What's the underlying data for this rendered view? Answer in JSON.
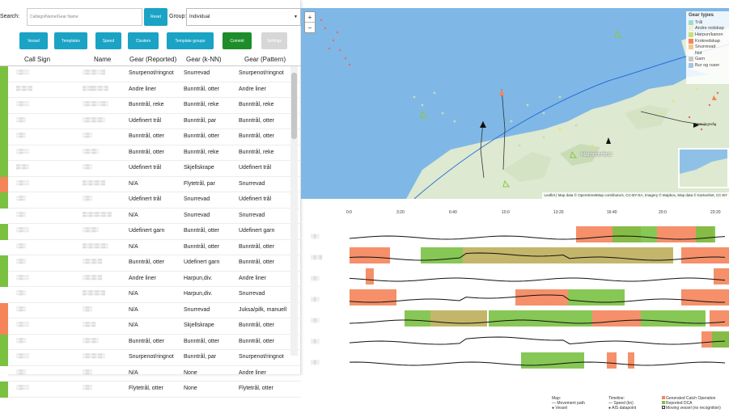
{
  "search": {
    "label": "Search:",
    "placeholder": "Callsign/Name/Gear Name",
    "reset_label": "Reset"
  },
  "group": {
    "label": "Group:",
    "value": "Individual"
  },
  "toolbar": {
    "vessel": "Vessel",
    "templates": "Templates",
    "speed": "Speed",
    "clusters": "Clusters",
    "template_groups": "Template groups",
    "commit": "Commit",
    "settings": "Settings"
  },
  "table": {
    "headers": [
      "Call Sign",
      "Name",
      "Gear (Reported)",
      "Gear (k-NN)",
      "Gear (Pattern)"
    ],
    "rows": [
      {
        "flag": "#7ac142",
        "cs": "░▒░░",
        "nm": "░▒░▒░░▒",
        "rep": "Snurpenot/ringnot",
        "knn": "Snurrevad",
        "pat": "Snurpenot/ringnot"
      },
      {
        "flag": "#7ac142",
        "cs": "▒░▒░▒",
        "nm": "▒░▒▒░▒░▒",
        "rep": "Andre liner",
        "knn": "Bunntrål, otter",
        "pat": "Andre liner"
      },
      {
        "flag": "#7ac142",
        "cs": "░▒░░",
        "nm": "░▒░▒░░▒░",
        "rep": "Bunntrål, reke",
        "knn": "Bunntrål, reke",
        "pat": "Bunntrål, reke"
      },
      {
        "flag": "#7ac142",
        "cs": "░▒░",
        "nm": "░▒░▒░▒░",
        "rep": "Udefinert trål",
        "knn": "Bunntrål, par",
        "pat": "Bunntrål, otter"
      },
      {
        "flag": "#7ac142",
        "cs": "░▒░",
        "nm": "░▒░",
        "rep": "Bunntrål, otter",
        "knn": "Bunntrål, otter",
        "pat": "Bunntrål, otter"
      },
      {
        "flag": "#7ac142",
        "cs": "░▒░░",
        "nm": "░▒░▒░",
        "rep": "Bunntrål, otter",
        "knn": "Bunntrål, reke",
        "pat": "Bunntrål, reke"
      },
      {
        "flag": "#7ac142",
        "cs": "▒░▒░",
        "nm": "░▒░",
        "rep": "Udefinert trål",
        "knn": "Skjellskrape",
        "pat": "Udefinert trål"
      },
      {
        "flag": "#f4845a",
        "cs": "░▒░░",
        "nm": "▒░▒░▒░▒",
        "rep": "N/A",
        "knn": "Flytetrål, par",
        "pat": "Snurrevad"
      },
      {
        "flag": "#7ac142",
        "cs": "░▒░",
        "nm": "░▒░",
        "rep": "Udefinert trål",
        "knn": "Snurrevad",
        "pat": "Udefinert trål"
      },
      {
        "flag": "#ffffff",
        "cs": "░▒░",
        "nm": "▒░▒░▒░▒░▒",
        "rep": "N/A",
        "knn": "Snurrevad",
        "pat": "Snurrevad"
      },
      {
        "flag": "#7ac142",
        "cs": "░▒░░",
        "nm": "░▒░▒░",
        "rep": "Udefinert garn",
        "knn": "Bunntrål, otter",
        "pat": "Udefinert garn"
      },
      {
        "flag": "#ffffff",
        "cs": "░▒░",
        "nm": "▒░▒░▒░▒░",
        "rep": "N/A",
        "knn": "Bunntrål, otter",
        "pat": "Bunntrål, otter"
      },
      {
        "flag": "#7ac142",
        "cs": "░▒░",
        "nm": "░▒░▒░▒",
        "rep": "Bunntrål, otter",
        "knn": "Udefinert garn",
        "pat": "Bunntrål, otter"
      },
      {
        "flag": "#7ac142",
        "cs": "░▒░░",
        "nm": "░▒░▒░▒",
        "rep": "Andre liner",
        "knn": "Harpun,div.",
        "pat": "Andre liner"
      },
      {
        "flag": "#ffffff",
        "cs": "░▒░",
        "nm": "▒░▒░▒░▒",
        "rep": "N/A",
        "knn": "Harpun,div.",
        "pat": "Snurrevad"
      },
      {
        "flag": "#f4845a",
        "cs": "░▒░",
        "nm": "░▒░",
        "rep": "N/A",
        "knn": "Snurrevad",
        "pat": "Juksa/pilk, manuell"
      },
      {
        "flag": "#f4845a",
        "cs": "░▒░░",
        "nm": "░▒░▒",
        "rep": "N/A",
        "knn": "Skjellskrape",
        "pat": "Bunntrål, otter"
      },
      {
        "flag": "#7ac142",
        "cs": "░▒░",
        "nm": "░▒░▒░",
        "rep": "Bunntrål, otter",
        "knn": "Bunntrål, otter",
        "pat": "Bunntrål, otter"
      },
      {
        "flag": "#7ac142",
        "cs": "░▒░░",
        "nm": "░▒░▒░▒░",
        "rep": "Snurpenot/ringnot",
        "knn": "Bunntrål, par",
        "pat": "Snurpenot/ringnot"
      },
      {
        "flag": "#ffffff",
        "cs": "░▒░",
        "nm": "░▒░",
        "rep": "N/A",
        "knn": "None",
        "pat": "Andre liner"
      },
      {
        "flag": "#7ac142",
        "cs": "░▒░░",
        "nm": "░▒░",
        "rep": "Flytetrål, otter",
        "knn": "None",
        "pat": "Flytetrål, otter"
      }
    ]
  },
  "map": {
    "zoom_in": "+",
    "zoom_out": "−",
    "legend_title": "Gear types",
    "legend": [
      {
        "label": "Trål",
        "color": "#9fdccf"
      },
      {
        "label": "Andre redskap",
        "color": "#f2f2c2"
      },
      {
        "label": "Harpun/kanon",
        "color": "#c9e07a"
      },
      {
        "label": "Krokredskap",
        "color": "#f4845a"
      },
      {
        "label": "Snurrevad",
        "color": "#f7c48a"
      },
      {
        "label": "Not",
        "color": "#ffffff"
      },
      {
        "label": "Garn",
        "color": "#c8c8c8"
      },
      {
        "label": "Bur og ruser",
        "color": "#a8c4e0"
      }
    ],
    "places": [
      "Hammerfest",
      "Honningsvåg"
    ],
    "attribution": "Leaflet | Map data © OpenStreetMap contributors, CC-BY-SA, Imagery © Mapbox, Map data © Kartverket, CC-BY"
  },
  "timeline": {
    "ticks": [
      "0:0",
      "3:20",
      "6:40",
      "10:0",
      "13:20",
      "16:40",
      "20:0",
      "23:20"
    ],
    "vessels": [
      "░▒░",
      "░▒░▒",
      "░▒░",
      "░▒░",
      "░▒░",
      "░▒░",
      "░▒░"
    ]
  },
  "footer": {
    "map_title": "Map:",
    "map_items": [
      "— Movement path",
      "● Vessel"
    ],
    "timeline_title": "Timeline:",
    "timeline_items": [
      "— Speed (kn)",
      "● AIS datapoint"
    ],
    "gen_items": [
      "Generated Catch Operation",
      "Reported DCA",
      "Moving vessel (no recognition)"
    ]
  },
  "colors": {
    "green": "#7ac142",
    "orange": "#f4845a",
    "accent": "#1aa3c4",
    "commit": "#1e8c2a"
  }
}
